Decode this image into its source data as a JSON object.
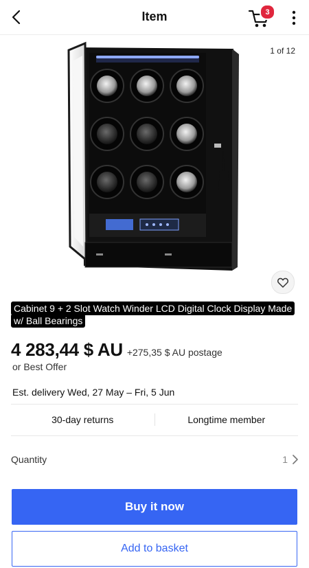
{
  "header": {
    "title": "Item",
    "cart_count": "3"
  },
  "gallery": {
    "counter": "1 of 12"
  },
  "listing": {
    "title_redacted": "Cabinet 9 + 2 Slot Watch Winder LCD Digital Clock Display Made w/ Ball Bearings"
  },
  "pricing": {
    "price": "4 283,44 $ AU",
    "postage": "+275,35 $ AU postage",
    "best_offer": "or Best Offer"
  },
  "delivery": {
    "label": "Est. delivery",
    "dates": "Wed, 27 May – Fri, 5 Jun"
  },
  "features": {
    "returns": "30-day returns",
    "member": "Longtime member"
  },
  "quantity": {
    "label": "Quantity",
    "value": "1"
  },
  "actions": {
    "buy": "Buy it now",
    "basket": "Add to basket"
  },
  "colors": {
    "accent": "#3665f3",
    "badge": "#e0263d"
  }
}
